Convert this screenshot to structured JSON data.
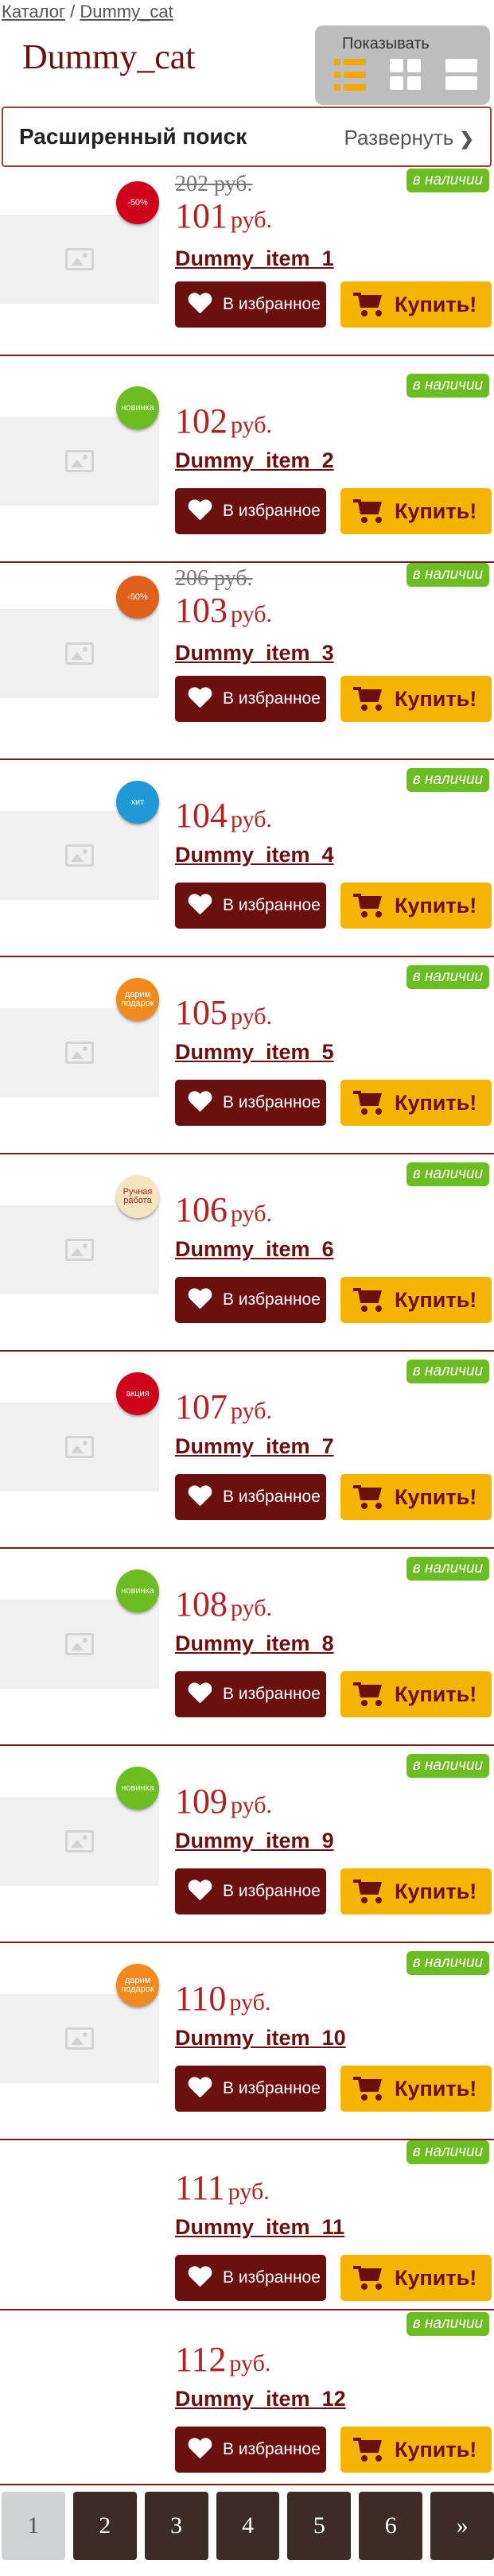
{
  "breadcrumb": {
    "root": "Каталог",
    "sep": "/",
    "current": "Dummy_cat"
  },
  "title": "Dummy_cat",
  "view": {
    "label": "Показывать",
    "active": "list",
    "options": [
      "list-icon",
      "grid-icon",
      "rows-icon"
    ]
  },
  "search": {
    "title": "Расширенный поиск",
    "expand": "Развернуть"
  },
  "currency": "руб.",
  "stock_label": "в наличии",
  "fav_label": "В избранное",
  "buy_label": "Купить!",
  "colors": {
    "brand": "#6b0f0f",
    "accent": "#f5b400",
    "stock": "#6cbd22",
    "price": "#b22222"
  },
  "items": [
    {
      "name": "Dummy_item_1",
      "price": "101",
      "old_price": "202 руб.",
      "badge": "-50%",
      "badge_color": "#d0021b"
    },
    {
      "name": "Dummy_item_2",
      "price": "102",
      "old_price": "",
      "badge": "новинка",
      "badge_color": "#6cbd22"
    },
    {
      "name": "Dummy_item_3",
      "price": "103",
      "old_price": "206 руб.",
      "badge": "-50%",
      "badge_color": "#e0611b"
    },
    {
      "name": "Dummy_item_4",
      "price": "104",
      "old_price": "",
      "badge": "хит",
      "badge_color": "#1f9ad6"
    },
    {
      "name": "Dummy_item_5",
      "price": "105",
      "old_price": "",
      "badge": "дарим подарок",
      "badge_color": "#f08a1c"
    },
    {
      "name": "Dummy_item_6",
      "price": "106",
      "old_price": "",
      "badge": "Ручная работа",
      "badge_color": "#f4e5c0"
    },
    {
      "name": "Dummy_item_7",
      "price": "107",
      "old_price": "",
      "badge": "акция",
      "badge_color": "#d0021b"
    },
    {
      "name": "Dummy_item_8",
      "price": "108",
      "old_price": "",
      "badge": "новинка",
      "badge_color": "#6cbd22"
    },
    {
      "name": "Dummy_item_9",
      "price": "109",
      "old_price": "",
      "badge": "новинка",
      "badge_color": "#6cbd22"
    },
    {
      "name": "Dummy_item_10",
      "price": "110",
      "old_price": "",
      "badge": "дарим подарок",
      "badge_color": "#f08a1c"
    },
    {
      "name": "Dummy_item_11",
      "price": "111",
      "old_price": "",
      "badge": "",
      "badge_color": ""
    },
    {
      "name": "Dummy_item_12",
      "price": "112",
      "old_price": "",
      "badge": "",
      "badge_color": ""
    }
  ],
  "pagination": {
    "pages": [
      "1",
      "2",
      "3",
      "4",
      "5",
      "6",
      "»"
    ],
    "active": "1"
  }
}
